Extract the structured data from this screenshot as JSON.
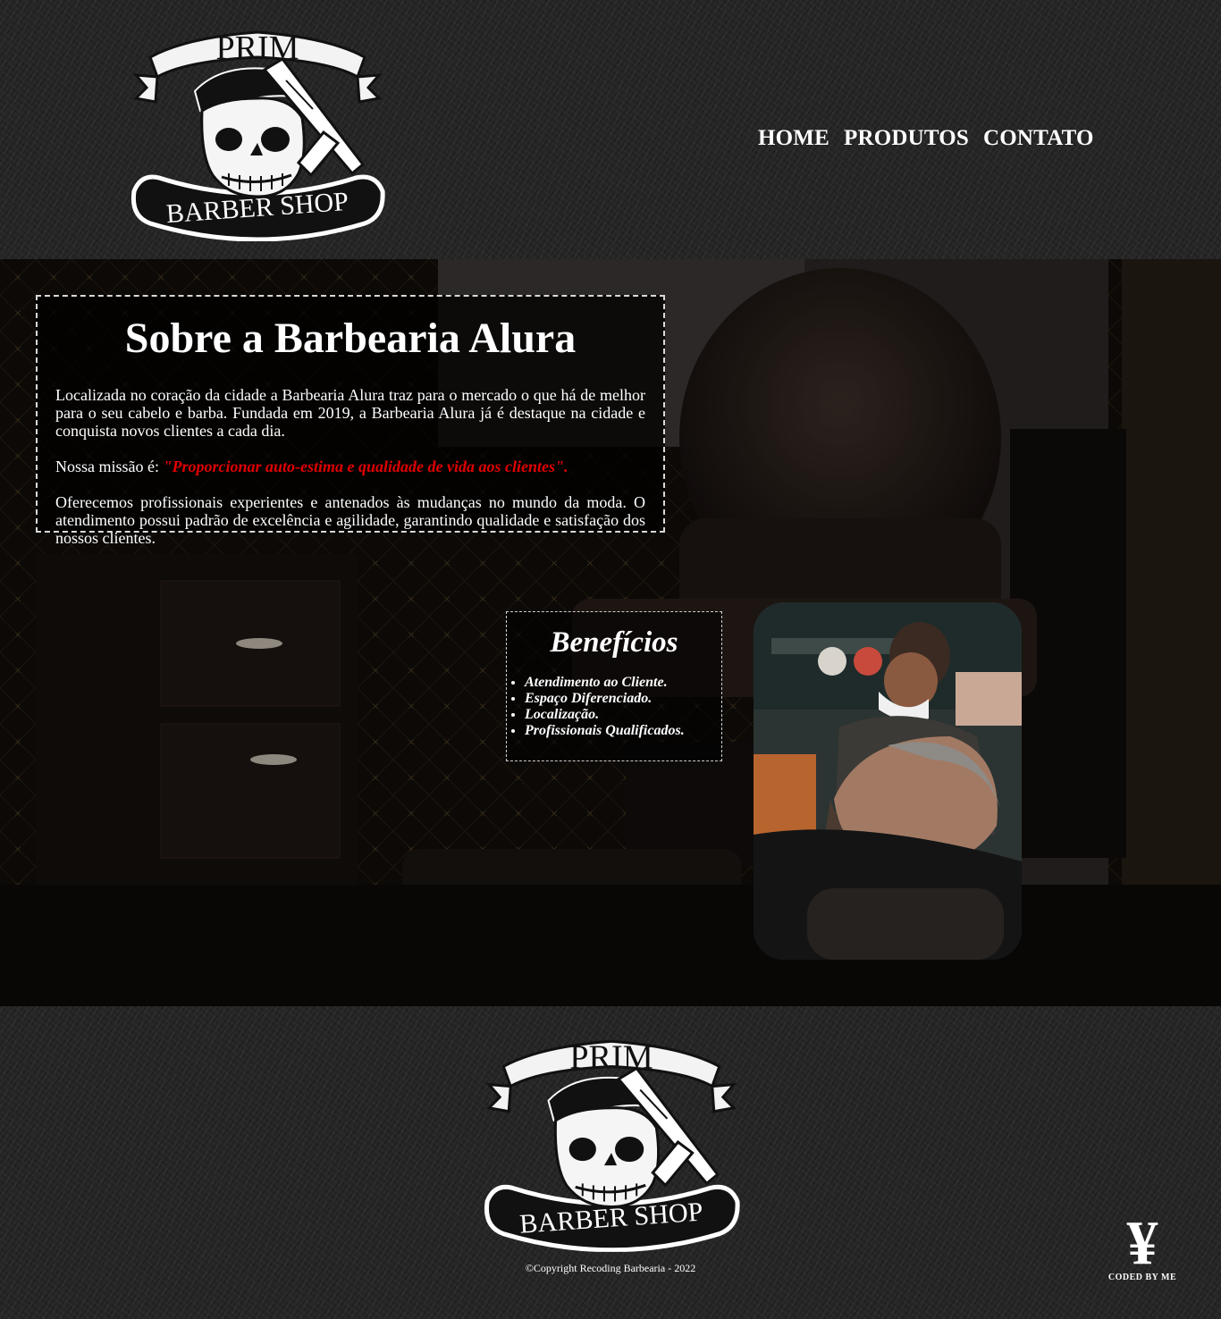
{
  "brand": {
    "logo_top_text": "PRIM",
    "logo_bottom_text": "BARBER SHOP"
  },
  "nav": {
    "items": [
      {
        "label": "HOME"
      },
      {
        "label": "PRODUTOS"
      },
      {
        "label": "CONTATO"
      }
    ]
  },
  "about": {
    "title": "Sobre a Barbearia Alura",
    "intro": "Localizada no coração da cidade a Barbearia Alura traz para o mercado o que há de melhor para o seu cabelo e barba. Fundada em 2019, a Barbearia Alura já é destaque na cidade e conquista novos clientes a cada dia.",
    "mission_prefix": "Nossa missão é: ",
    "mission_quote": "\"Proporcionar auto-estima e qualidade de vida aos clientes\".",
    "services": "Oferecemos profissionais experientes e antenados às mudanças no mundo da moda. O atendimento possui padrão de excelência e agilidade, garantindo qualidade e satisfação dos nossos clientes."
  },
  "benefits": {
    "title": "Benefícios",
    "items": [
      "Atendimento ao Cliente.",
      "Espaço Diferenciado.",
      "Localização.",
      "Profissionais Qualificados."
    ]
  },
  "footer": {
    "copyright": "©Copyright Recoding Barbearia - 2022",
    "coded_glyph": "¥",
    "coded_caption": "CODED BY ME"
  },
  "colors": {
    "mission_highlight": "#e00000",
    "text": "#ffffff",
    "page_texture": "#262626"
  }
}
